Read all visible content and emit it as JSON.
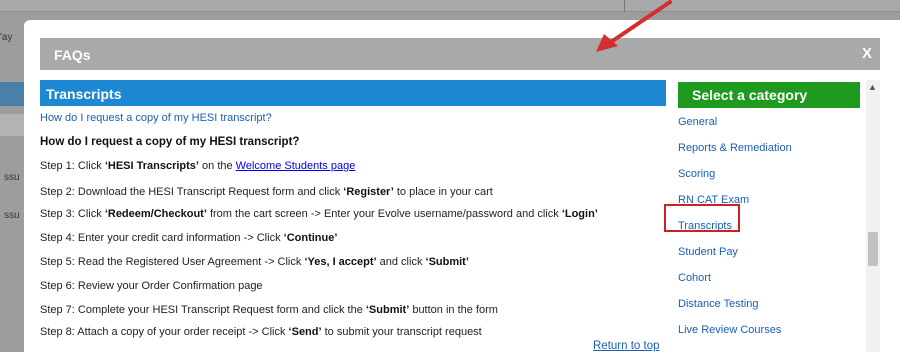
{
  "background": {
    "fragment_top": "'ay",
    "fragment_mid1": "ssu",
    "fragment_mid2": "ssu"
  },
  "modal": {
    "title": "FAQs",
    "close_label": "X"
  },
  "section": {
    "title": "Transcripts",
    "question_link": "How do I request a copy of my HESI transcript?",
    "question_heading": "How do I request a copy of my HESI transcript?",
    "return_to_top": "Return to top"
  },
  "steps": {
    "s1_a": "Step 1: Click ",
    "s1_b": "‘HESI Transcripts’",
    "s1_c": " on the ",
    "s1_link": "Welcome Students page",
    "s2_a": "Step 2: Download the HESI Transcript Request form and click ",
    "s2_b": "‘Register’",
    "s2_c": " to place in your cart",
    "s3_a": "Step 3: Click ",
    "s3_b": "‘Redeem/Checkout’",
    "s3_c": " from the cart screen -> Enter your Evolve username/password and click ",
    "s3_d": "‘Login’",
    "s4_a": "Step 4: Enter your credit card information -> Click ",
    "s4_b": "‘Continue’",
    "s5_a": "Step 5: Read the Registered User Agreement -> Click ",
    "s5_b": "‘Yes, I accept’",
    "s5_c": " and click ",
    "s5_d": "‘Submit’",
    "s6": "Step 6: Review your Order Confirmation page",
    "s7_a": "Step 7: Complete your HESI Transcript Request form and click the ",
    "s7_b": "‘Submit’",
    "s7_c": " button in the form",
    "s8_a": "Step 8: Attach a copy of your order receipt -> Click ",
    "s8_b": "‘Send’",
    "s8_c": " to submit your transcript request"
  },
  "sidebar": {
    "title": "Select a category",
    "items": [
      {
        "label": "General"
      },
      {
        "label": "Reports & Remediation"
      },
      {
        "label": "Scoring"
      },
      {
        "label": "RN CAT Exam"
      },
      {
        "label": "Transcripts"
      },
      {
        "label": "Student Pay"
      },
      {
        "label": "Cohort"
      },
      {
        "label": "Distance Testing"
      },
      {
        "label": "Live Review Courses"
      }
    ],
    "highlighted_item": "Transcripts"
  },
  "colors": {
    "section_header": "#1e88d2",
    "category_header": "#1e9a1e",
    "modal_header": "#a9a9a9",
    "link": "#1a5fb4",
    "annotation": "#d32f2f"
  }
}
